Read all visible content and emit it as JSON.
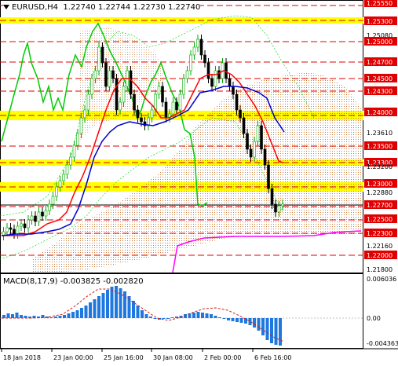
{
  "header": {
    "symbol_timeframe": "EURUSD,H4",
    "ohlc": "1.22740 1.22744 1.22730 1.22740"
  },
  "macd": {
    "label": "MACD(8,17,9) -0.003825 -0.002820",
    "scale_top": "0.006036",
    "scale_zero": "0.00",
    "scale_bottom": "-0.004363"
  },
  "price_axis": {
    "labels": [
      "1.25550",
      "1.25300",
      "1.25080",
      "1.25000",
      "1.24700",
      "1.24500",
      "1.24300",
      "1.24000",
      "1.23610",
      "1.23500",
      "1.23300",
      "1.23200",
      "1.23000",
      "1.22880",
      "1.22700",
      "1.22500",
      "1.22300",
      "1.22160",
      "1.22000",
      "1.21800"
    ],
    "highlighted": [
      "1.25550",
      "1.25300",
      "1.25000",
      "1.24700",
      "1.24500",
      "1.24300",
      "1.24000",
      "1.23500",
      "1.23300",
      "1.23000",
      "1.22700",
      "1.22500",
      "1.22300",
      "1.22000"
    ]
  },
  "time_axis": {
    "labels": [
      "18 Jan 2018",
      "23 Jan 00:00",
      "25 Jan 16:00",
      "30 Jan 08:00",
      "2 Feb 00:00",
      "6 Feb 16:00"
    ]
  },
  "colors": {
    "level_line": "#e00000",
    "yellow_zone": "#ffff00",
    "candle_up": "#00aa00",
    "candle_down": "#000000",
    "ma_red": "#ff0000",
    "ma_blue": "#0000cc",
    "green_line": "#00cc00",
    "magenta_line": "#ff00ff",
    "cloud_dots": "#c87a3a",
    "macd_hist": "#1e78e0",
    "macd_signal": "#d22020"
  }
}
